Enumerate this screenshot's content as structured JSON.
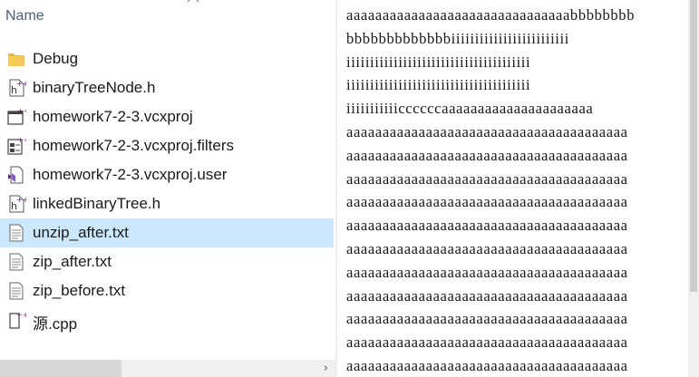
{
  "file_list": {
    "column_header": "Name",
    "sort_icon": "chevron-up-icon",
    "items": [
      {
        "name": "Debug",
        "icon": "folder-icon",
        "selected": false
      },
      {
        "name": "binaryTreeNode.h",
        "icon": "cpp-header-file-icon",
        "selected": false
      },
      {
        "name": "homework7-2-3.vcxproj",
        "icon": "vcxproj-file-icon",
        "selected": false
      },
      {
        "name": "homework7-2-3.vcxproj.filters",
        "icon": "filters-file-icon",
        "selected": false
      },
      {
        "name": "homework7-2-3.vcxproj.user",
        "icon": "visual-studio-user-file-icon",
        "selected": false
      },
      {
        "name": "linkedBinaryTree.h",
        "icon": "cpp-header-file-icon",
        "selected": false
      },
      {
        "name": "unzip_after.txt",
        "icon": "text-file-icon",
        "selected": true
      },
      {
        "name": "zip_after.txt",
        "icon": "text-file-icon",
        "selected": false
      },
      {
        "name": "zip_before.txt",
        "icon": "text-file-icon",
        "selected": false
      },
      {
        "name": "源.cpp",
        "icon": "cpp-source-file-icon",
        "selected": false
      }
    ]
  },
  "preview": {
    "lines": [
      "aaaaaaaaaaaaaaaaaaaaaaaaaaaaaaabbbbbbbb",
      "bbbbbbbbbbbbbiiiiiiiiiiiiiiiiiiiiiiiii",
      "iiiiiiiiiiiiiiiiiiiiiiiiiiiiiiiiiiiiiii",
      "iiiiiiiiiiiiiiiiiiiiiiiiiiiiiiiiiiiiiii",
      "iiiiiiiiiiiccccccaaaaaaaaaaaaaaaaaaaaa",
      "aaaaaaaaaaaaaaaaaaaaaaaaaaaaaaaaaaaaaaa",
      "aaaaaaaaaaaaaaaaaaaaaaaaaaaaaaaaaaaaaaa",
      "aaaaaaaaaaaaaaaaaaaaaaaaaaaaaaaaaaaaaaa",
      "aaaaaaaaaaaaaaaaaaaaaaaaaaaaaaaaaaaaaaa",
      "aaaaaaaaaaaaaaaaaaaaaaaaaaaaaaaaaaaaaaa",
      "aaaaaaaaaaaaaaaaaaaaaaaaaaaaaaaaaaaaaaa",
      "aaaaaaaaaaaaaaaaaaaaaaaaaaaaaaaaaaaaaaa",
      "aaaaaaaaaaaaaaaaaaaaaaaaaaaaaaaaaaaaaaa",
      "aaaaaaaaaaaaaaaaaaaaaaaaaaaaaaaaaaaaaaa",
      "aaaaaaaaaaaaaaaaaaaaaaaaaaaaaaaaaaaaaaa",
      "aaaaaaaaaaaaaaaaaaaaaaaaaaaaaaaaaaaaaaa"
    ]
  },
  "scrollbar": {
    "horizontal_arrow": "›"
  },
  "colors": {
    "selection": "#cce8ff",
    "header_text": "#4c607a",
    "folder": "#e8b84a",
    "vs_purple": "#68217a"
  }
}
